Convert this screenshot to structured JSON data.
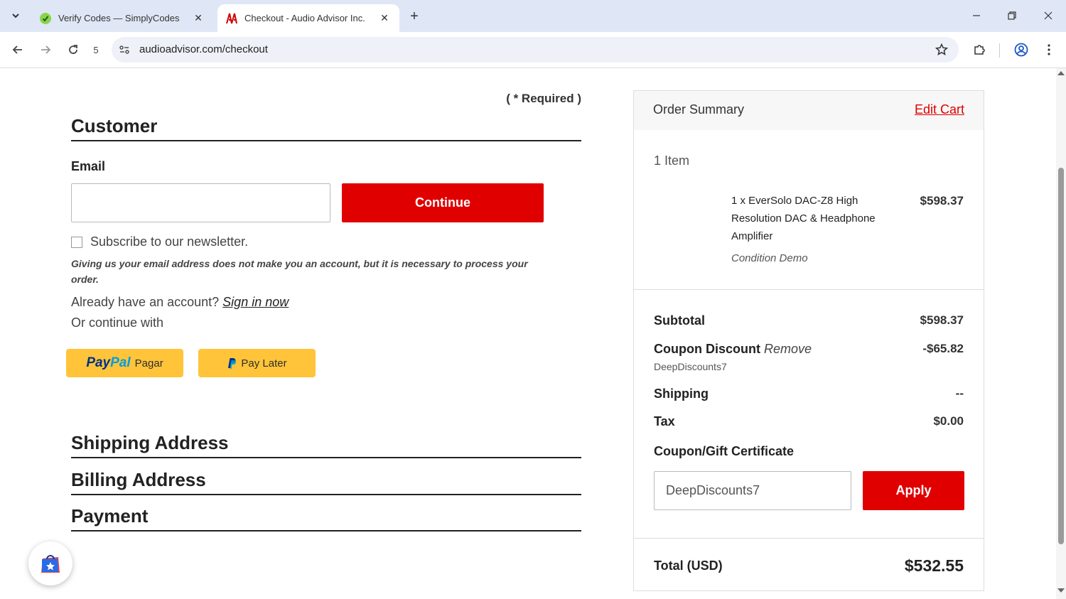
{
  "browser": {
    "tabs": [
      {
        "title": "Verify Codes — SimplyCodes",
        "active": false
      },
      {
        "title": "Checkout - Audio Advisor Inc.",
        "active": true
      }
    ],
    "url": "audioadvisor.com/checkout",
    "history_count": "5"
  },
  "checkout": {
    "required_note": "( * Required )",
    "customer_heading": "Customer",
    "email_label": "Email",
    "email_value": "",
    "continue_label": "Continue",
    "newsletter_label": "Subscribe to our newsletter.",
    "disclaimer": "Giving us your email address does not make you an account, but it is necessary to process your order.",
    "account_prompt": "Already have an account?",
    "sign_in_label": "Sign in now",
    "continue_with": "Or continue with",
    "paypal_word_1": "Pay",
    "paypal_word_2": "Pal",
    "paypal_label": "Pagar",
    "paylater_label": "Pay Later",
    "shipping_heading": "Shipping Address",
    "billing_heading": "Billing Address",
    "payment_heading": "Payment"
  },
  "summary": {
    "title": "Order Summary",
    "edit_cart": "Edit Cart",
    "item_count": "1 Item",
    "item": {
      "name": "1 x EverSolo DAC-Z8 High Resolution DAC & Headphone Amplifier",
      "condition": "Condition Demo",
      "price": "$598.37"
    },
    "subtotal_label": "Subtotal",
    "subtotal": "$598.37",
    "coupon_label": "Coupon Discount",
    "coupon_remove": "Remove",
    "coupon_discount": "-$65.82",
    "coupon_code": "DeepDiscounts7",
    "shipping_label": "Shipping",
    "shipping": "--",
    "tax_label": "Tax",
    "tax": "$0.00",
    "gift_label": "Coupon/Gift Certificate",
    "gift_input_value": "DeepDiscounts7",
    "apply_label": "Apply",
    "total_label": "Total (USD)",
    "total": "$532.55"
  },
  "colors": {
    "accent": "#e00000",
    "paypal_yellow": "#ffc439",
    "tabbar": "#dfe7f6"
  }
}
